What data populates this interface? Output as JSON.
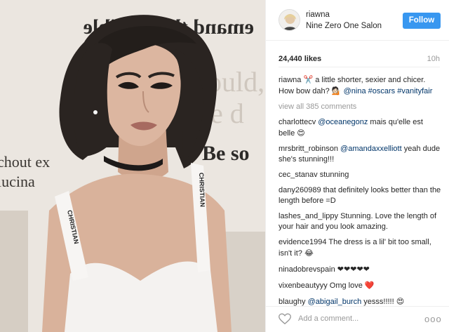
{
  "header": {
    "username": "riawna",
    "location": "Nine Zero One Salon",
    "follow_label": "Follow"
  },
  "post": {
    "likes": "24,440 likes",
    "time": "10h",
    "caption_user": "riawna",
    "caption_emoji": "✂️",
    "caption_text": " a little shorter, sexier and chicer. How bow dah? ",
    "caption_emoji2": "💁🏻",
    "caption_tag1": "@nina",
    "caption_tag2": "#oscars",
    "caption_tag3": "#vanityfair",
    "view_all": "view all 385 comments"
  },
  "comments": [
    {
      "user": "charlottecv",
      "mention": "@oceanegonz",
      "text": " mais qu'elle est belle ",
      "emoji": "😍"
    },
    {
      "user": "mrsbritt_robinson",
      "mention": "@amandaxxelliott",
      "text": " yeah dude she's stunning!!!",
      "emoji": ""
    },
    {
      "user": "cec_stanav",
      "mention": "",
      "text": "stunning",
      "emoji": ""
    },
    {
      "user": "dany260989",
      "mention": "",
      "text": "that definitely looks better than the length before =D",
      "emoji": ""
    },
    {
      "user": "lashes_and_lippy",
      "mention": "",
      "text": "Stunning. Love the length of your hair and you look amazing.",
      "emoji": ""
    },
    {
      "user": "evidence1994",
      "mention": "",
      "text": "The dress is a lil' bit too small, isn't it? ",
      "emoji": "😂"
    },
    {
      "user": "ninadobrevspain",
      "mention": "",
      "text": "❤❤❤❤❤",
      "emoji": ""
    },
    {
      "user": "vixenbeautyyy",
      "mention": "",
      "text": "Omg love ",
      "emoji": "❤️"
    },
    {
      "user": "blaughy",
      "mention": "@abigail_burch",
      "text": " yesss!!!!! ",
      "emoji": "😍"
    }
  ],
  "footer": {
    "add_comment_placeholder": "Add a comment...",
    "more_label": "ooo"
  },
  "photo": {
    "background_text_1": "emand the possible",
    "background_text_2": "ould,",
    "background_text_3": "e d",
    "background_text_4": "Be so",
    "background_text_5": "chout ex",
    "background_text_6": "lucina",
    "strap_text": "CHRISTIAN",
    "colors": {
      "skin": "#d9b29b",
      "hair": "#2a2421",
      "dress": "#f4f2f0",
      "wall": "#ebe6e0"
    }
  },
  "colors": {
    "accent": "#3897f0",
    "link": "#003569",
    "muted": "#999999"
  }
}
